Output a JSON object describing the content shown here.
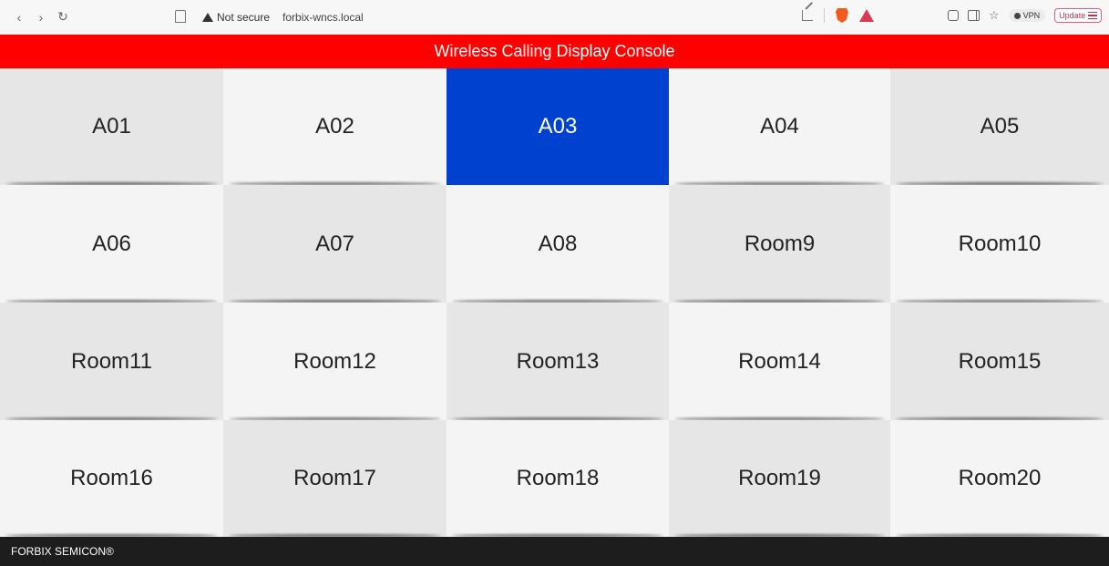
{
  "browser": {
    "security_label": "Not secure",
    "url": "forbix-wncs.local",
    "vpn_label": "VPN",
    "update_label": "Update"
  },
  "page": {
    "title": "Wireless Calling Display Console",
    "footer": "FORBIX SEMICON®"
  },
  "rooms": [
    {
      "label": "A01",
      "active": false
    },
    {
      "label": "A02",
      "active": false
    },
    {
      "label": "A03",
      "active": true
    },
    {
      "label": "A04",
      "active": false
    },
    {
      "label": "A05",
      "active": false
    },
    {
      "label": "A06",
      "active": false
    },
    {
      "label": "A07",
      "active": false
    },
    {
      "label": "A08",
      "active": false
    },
    {
      "label": "Room9",
      "active": false
    },
    {
      "label": "Room10",
      "active": false
    },
    {
      "label": "Room11",
      "active": false
    },
    {
      "label": "Room12",
      "active": false
    },
    {
      "label": "Room13",
      "active": false
    },
    {
      "label": "Room14",
      "active": false
    },
    {
      "label": "Room15",
      "active": false
    },
    {
      "label": "Room16",
      "active": false
    },
    {
      "label": "Room17",
      "active": false
    },
    {
      "label": "Room18",
      "active": false
    },
    {
      "label": "Room19",
      "active": false
    },
    {
      "label": "Room20",
      "active": false
    }
  ],
  "colors": {
    "header": "#ff0000",
    "active_tile": "#0042cf",
    "footer": "#1d1d1d"
  }
}
